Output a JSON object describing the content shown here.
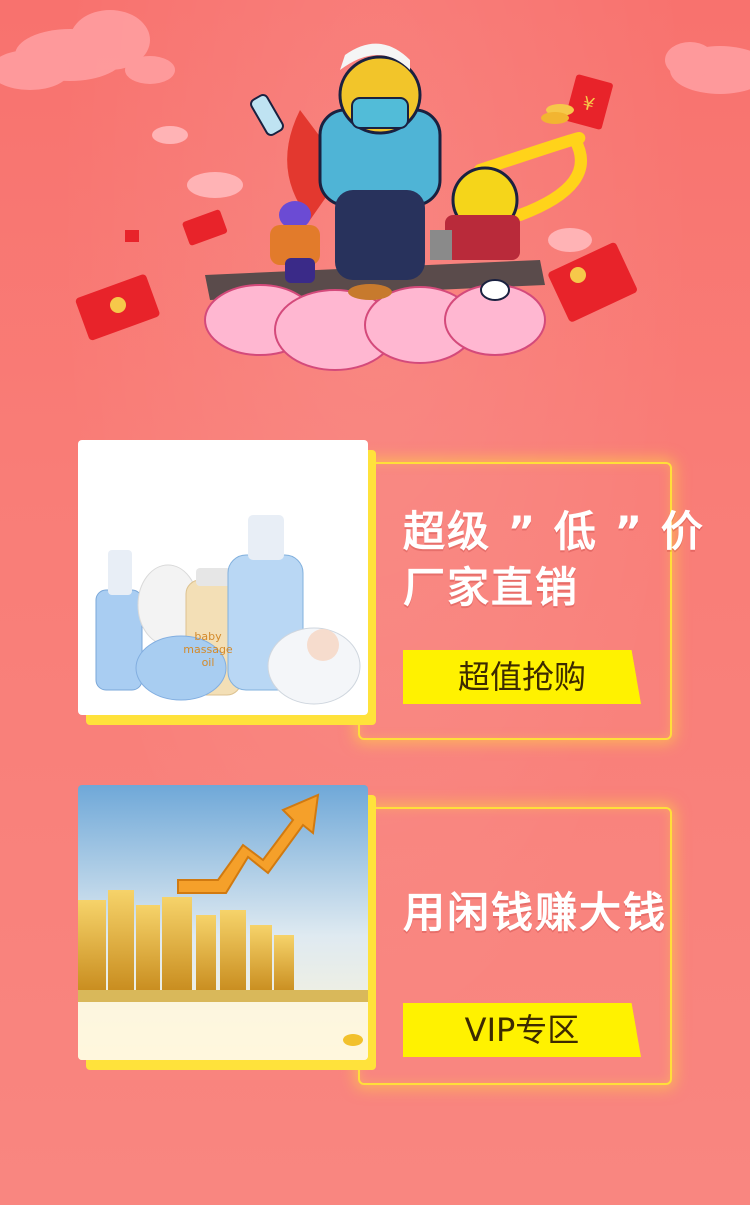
{
  "promo_cards": [
    {
      "title_line_1": "超级 ” 低 ” 价",
      "title_line_2": "厂家直销",
      "button_label": "超值抢购",
      "image": "baby-skincare-products"
    },
    {
      "title_line_1": "用闲钱赚大钱",
      "button_label": "VIP专区",
      "image": "city-skyline-growth-arrow"
    }
  ],
  "hero": {
    "image": "cartoon-characters-riding-cloud-with-red-envelopes"
  },
  "colors": {
    "background": "#f97a74",
    "accent_yellow": "#fff200",
    "border_glow": "#ffdf3a",
    "text_white": "#ffffff",
    "button_text": "#3c2a00"
  }
}
